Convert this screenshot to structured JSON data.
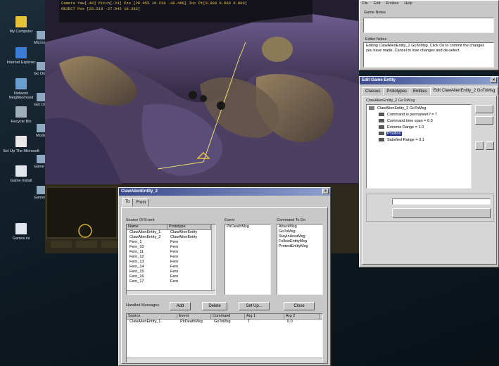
{
  "desktop": {
    "icons": [
      {
        "label": "My Computer",
        "icon": "my-computer-icon",
        "color": "#e6c43a"
      },
      {
        "label": "Internet Explorer",
        "icon": "internet-explorer-icon",
        "color": "#3a7bd5"
      },
      {
        "label": "Network Neighborhood",
        "icon": "network-icon",
        "color": "#6aa0d0"
      },
      {
        "label": "Recycle Bin",
        "icon": "recycle-bin-icon",
        "color": "#9fb0b8"
      },
      {
        "label": "Set Up The Microsoft",
        "icon": "msn-icon",
        "color": "#e8e8e8"
      },
      {
        "label": "Game Install",
        "icon": "document-icon",
        "color": "#dfe6ee"
      },
      {
        "label": "Games.ini",
        "icon": "file-icon",
        "color": "#dfe6ee"
      }
    ],
    "second_column": [
      "Microsoft",
      "Go Online",
      "Get On The",
      "Mode",
      "Game Install",
      "Games.ini"
    ]
  },
  "viewport": {
    "hud": [
      "Camera  Yaw[-40] Pitch[-24] Pos [26.055 10.210 -40.468] Inc Pt[0.000 0.000 0.000]",
      "OBJECT  Pos [25.518 -27.042 10.382]"
    ]
  },
  "notes_window": {
    "menu": [
      "File",
      "Edit",
      "Entities",
      "Help"
    ],
    "game_notes_label": "Game Notes",
    "editor_notes_label": "Editor Notes",
    "editor_notes_text": "Editing ClawAlienEntity_2 GoToMsg. Click Ok to commit the changes you have made, Cancel to lose changes and de-select."
  },
  "edit_window": {
    "title": "Edit Game Entity",
    "tabs": [
      "Classes",
      "Prototypes",
      "Entities",
      "Edit ClawAlienEntity_2 GoToMsg"
    ],
    "header": "ClawAlienEntity_2 GoToMsg",
    "tree": [
      {
        "text": "ClawAlienEntity_2 GoToMsg",
        "indent": 0,
        "selected": false
      },
      {
        "text": "Command is permanent? = T",
        "indent": 1,
        "selected": false
      },
      {
        "text": "Command time span = 0.0",
        "indent": 1,
        "selected": false
      },
      {
        "text": "Extreme Range = 1.0",
        "indent": 1,
        "selected": false
      },
      {
        "text": "Position",
        "indent": 1,
        "selected": true
      },
      {
        "text": "Satisfied Range = 0.1",
        "indent": 1,
        "selected": false
      }
    ]
  },
  "dialog": {
    "title": "ClawAlienEntity_2",
    "tabs": [
      "To",
      "From"
    ],
    "source_label": "Source Of Event",
    "event_label": "Event",
    "command_label": "Command To Do",
    "source_columns": [
      "Name",
      "Prototype"
    ],
    "source_rows": [
      [
        "ClawAlienEntity_1",
        "ClawAlienEntity"
      ],
      [
        "ClawAlienEntity_2",
        "ClawAlienEntity"
      ],
      [
        "Fern_1",
        "Fern"
      ],
      [
        "Fern_10",
        "Fern"
      ],
      [
        "Fern_11",
        "Fern"
      ],
      [
        "Fern_12",
        "Fern"
      ],
      [
        "Fern_13",
        "Fern"
      ],
      [
        "Fern_14",
        "Fern"
      ],
      [
        "Fern_15",
        "Fern"
      ],
      [
        "Fern_16",
        "Fern"
      ],
      [
        "Fern_17",
        "Fern"
      ]
    ],
    "events": [
      "PlrDeathMsg"
    ],
    "commands": [
      "AttackMsg",
      "GoToMsg",
      "StayInAreaMsg",
      "FollowEntityMsg",
      "ProtectEntityMsg"
    ],
    "handled_label": "Handled Messages",
    "buttons": [
      "Add",
      "Delete",
      "Set Up...",
      "Close"
    ],
    "handled_columns": [
      "Source",
      "Event",
      "Command",
      "Arg 1",
      "Arg 2"
    ],
    "handled_rows": [
      [
        "ClawAlienEntity_1",
        "PlrDeathMsg",
        "GoToMsg",
        "T",
        "0.0"
      ]
    ]
  }
}
